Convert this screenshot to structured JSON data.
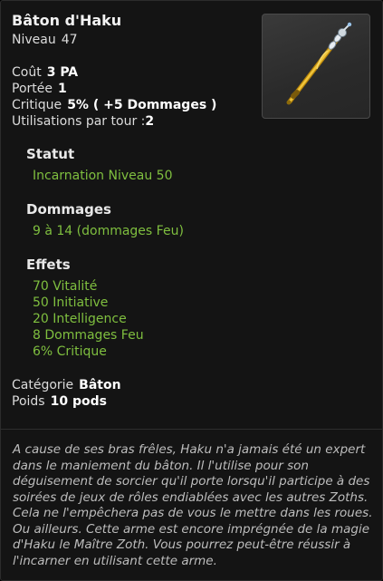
{
  "item": {
    "name": "Bâton d'Haku",
    "level_label": "Niveau",
    "level_value": "47"
  },
  "stats": {
    "cost_label": "Coût",
    "cost_value": "3 PA",
    "range_label": "Portée",
    "range_value": "1",
    "critical_label": "Critique",
    "critical_value": "5% ( +5 Dommages )",
    "uses_label": "Utilisations par tour :",
    "uses_value": "2"
  },
  "sections": {
    "status_title": "Statut",
    "status_value": "Incarnation Niveau 50",
    "damage_title": "Dommages",
    "damage_value": "9 à 14 (dommages Feu)",
    "effects_title": "Effets",
    "effects": [
      "70 Vitalité",
      "50 Initiative",
      "20 Intelligence",
      "8 Dommages Feu",
      "6% Critique"
    ]
  },
  "meta": {
    "category_label": "Catégorie",
    "category_value": "Bâton",
    "weight_label": "Poids",
    "weight_value": "10 pods"
  },
  "description": "A cause de ses bras frêles, Haku n'a jamais été un expert dans le maniement du bâton. Il l'utilise pour son déguisement de sorcier qu'il porte lorsqu'il participe à des soirées de jeux de rôles endiablées avec les autres Zoths. Cela ne l'empêchera pas de vous le mettre dans les roues. Ou ailleurs. Cette arme est encore imprégnée de la magie d'Haku le Maître Zoth. Vous pourrez peut-être réussir à l'incarner en utilisant cette arme.",
  "colors": {
    "background": "#141414",
    "effect_text": "#7fbf3f",
    "staff_gold": "#d9a521"
  },
  "icons": {
    "item_image": "staff-icon"
  }
}
